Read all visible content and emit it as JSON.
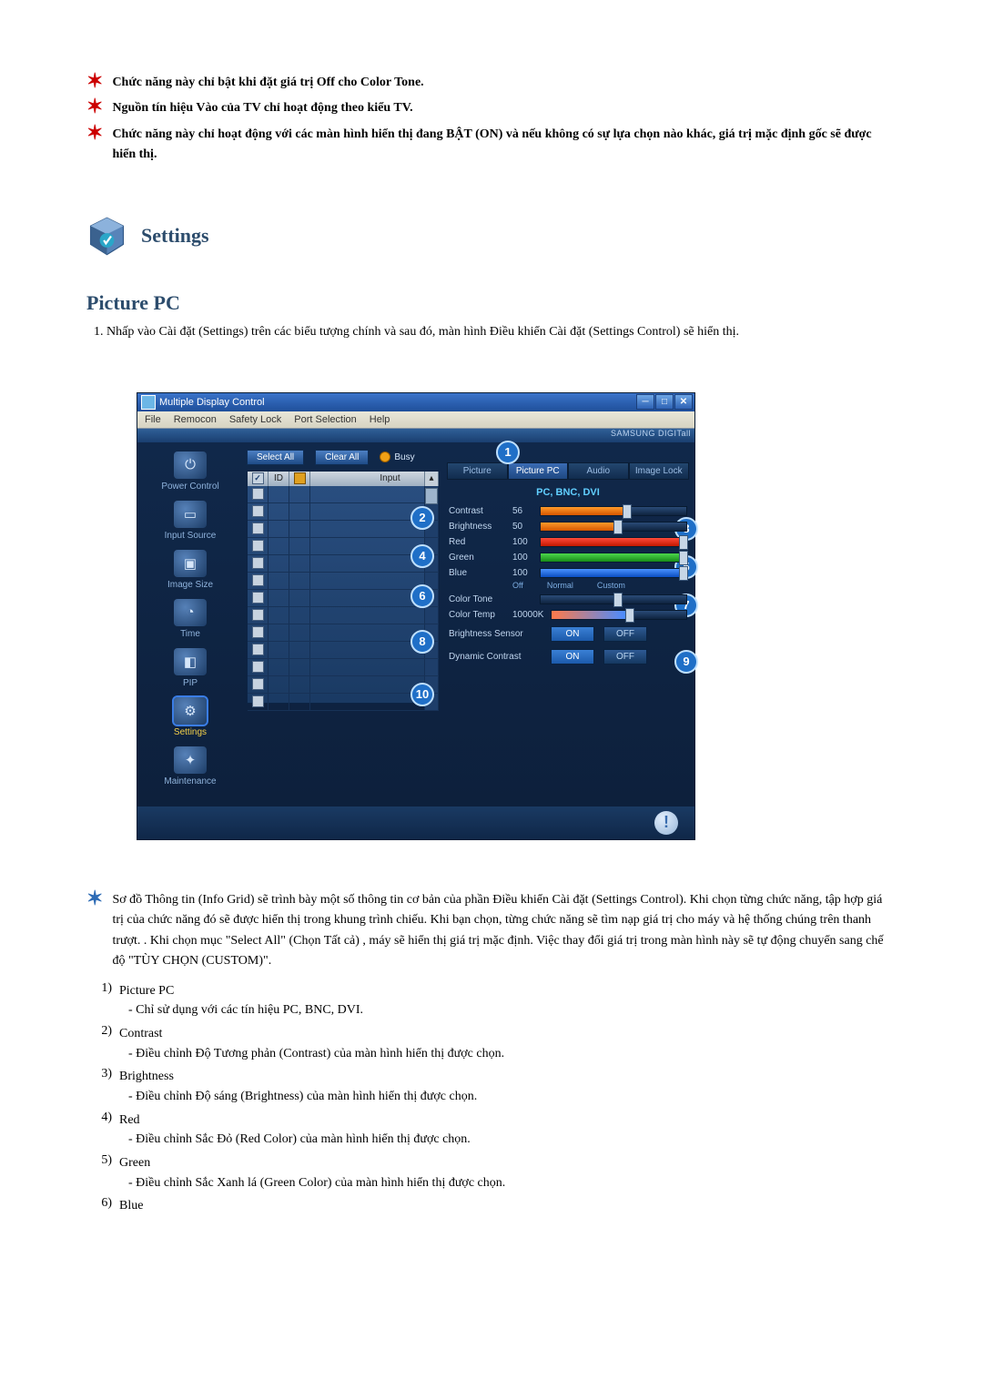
{
  "top_notes": [
    "Chức năng này chỉ bật khi đặt giá trị Off cho Color Tone.",
    "Nguồn tín hiệu Vào của TV chỉ hoạt động theo kiểu TV.",
    "Chức năng này chỉ hoạt động với các màn hình hiển thị đang BẬT (ON) và nếu không có sự lựa chọn nào khác, giá trị mặc định gốc sẽ được hiển thị."
  ],
  "settings_heading": "Settings",
  "section_title": "Picture PC",
  "intro_list_item": "Nhấp vào Cài đặt (Settings) trên các biểu tượng chính và sau đó, màn hình Điều khiển Cài đặt (Settings Control) sẽ hiển thị.",
  "app": {
    "title": "Multiple Display Control",
    "menu": [
      "File",
      "Remocon",
      "Safety Lock",
      "Port Selection",
      "Help"
    ],
    "brand": "SAMSUNG DIGITall",
    "toolbar": {
      "select_all": "Select All",
      "clear_all": "Clear All",
      "busy": "Busy"
    },
    "sidebar": [
      {
        "label": "Power Control",
        "glyph": "⏻"
      },
      {
        "label": "Input Source",
        "glyph": "▭"
      },
      {
        "label": "Image Size",
        "glyph": "▣"
      },
      {
        "label": "Time",
        "glyph": "◔"
      },
      {
        "label": "PIP",
        "glyph": "◧"
      },
      {
        "label": "Settings",
        "glyph": "⚙",
        "active": true
      },
      {
        "label": "Maintenance",
        "glyph": "✦"
      }
    ],
    "grid_headers": {
      "id": "ID",
      "input": "Input"
    },
    "grid_row_count": 13,
    "tabs": [
      "Picture",
      "Picture PC",
      "Audio",
      "Image Lock"
    ],
    "active_tab": 1,
    "sublabel": "PC, BNC, DVI",
    "sliders": {
      "contrast": {
        "label": "Contrast",
        "value": "56"
      },
      "brightness": {
        "label": "Brightness",
        "value": "50"
      },
      "red": {
        "label": "Red",
        "value": "100"
      },
      "green": {
        "label": "Green",
        "value": "100"
      },
      "blue": {
        "label": "Blue",
        "value": "100"
      }
    },
    "color_tone": {
      "label": "Color Tone",
      "opts": [
        "Off",
        "Normal",
        "Custom"
      ]
    },
    "color_temp": {
      "label": "Color Temp",
      "value": "10000K"
    },
    "brightness_sensor": {
      "label": "Brightness Sensor",
      "on": "ON",
      "off": "OFF"
    },
    "dynamic_contrast": {
      "label": "Dynamic Contrast",
      "on": "ON",
      "off": "OFF"
    },
    "callouts": [
      "1",
      "2",
      "3",
      "4",
      "5",
      "6",
      "7",
      "8",
      "9",
      "10"
    ]
  },
  "after_star": "Sơ đồ Thông tin (Info Grid) sẽ trình bày một số thông tin cơ bản của phần Điều khiển Cài đặt (Settings Control). Khi chọn từng chức năng, tập hợp giá trị của chức năng đó sẽ được hiển thị trong khung trình chiếu. Khi bạn chọn, từng chức năng sẽ tìm nạp giá trị cho máy và hệ thống chúng trên thanh trượt. . Khi chọn mục \"Select All\" (Chọn Tất cả) , máy sẽ hiển thị giá trị mặc định. Việc thay đổi giá trị trong màn hình này sẽ tự động chuyển sang chế độ \"TÙY CHỌN (CUSTOM)\".",
  "explain": [
    {
      "n": "1)",
      "title": "Picture PC",
      "sub": "- Chỉ sử dụng với các tín hiệu PC, BNC, DVI."
    },
    {
      "n": "2)",
      "title": "Contrast",
      "sub": "- Điều chỉnh Độ Tương phản (Contrast) của màn hình hiển thị được chọn."
    },
    {
      "n": "3)",
      "title": "Brightness",
      "sub": "- Điều chỉnh Độ sáng (Brightness) của màn hình hiển thị được chọn."
    },
    {
      "n": "4)",
      "title": "Red",
      "sub": "- Điều chỉnh Sắc Đỏ (Red Color) của màn hình hiển thị được chọn."
    },
    {
      "n": "5)",
      "title": "Green",
      "sub": "- Điều chỉnh Sắc Xanh lá (Green Color) của màn hình hiển thị được chọn."
    },
    {
      "n": "6)",
      "title": "Blue",
      "sub": ""
    }
  ]
}
